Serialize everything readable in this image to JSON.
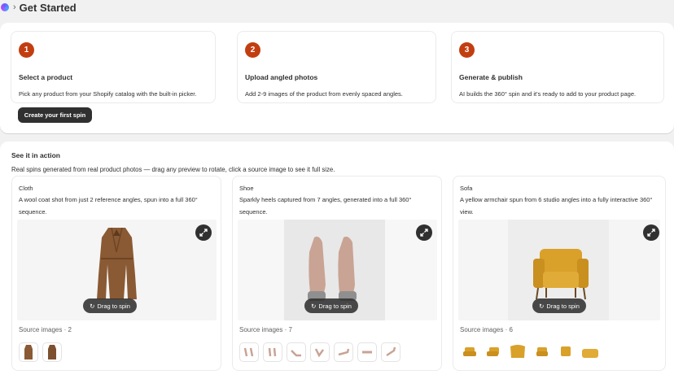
{
  "header": {
    "title": "Get Started"
  },
  "steps": [
    {
      "number": "1",
      "title": "Select a product",
      "description": "Pick any product from your Shopify catalog with the built-in picker."
    },
    {
      "number": "2",
      "title": "Upload angled photos",
      "description": "Add 2-9 images of the product from evenly spaced angles."
    },
    {
      "number": "3",
      "title": "Generate & publish",
      "description": "AI builds the 360° spin and it's ready to add to your product page."
    }
  ],
  "cta": {
    "label": "Create your first spin"
  },
  "demo": {
    "title": "See it in action",
    "subtitle": "Real spins generated from real product photos — drag any preview to rotate, click a source image to see it full size.",
    "drag_label": "Drag to spin",
    "examples": [
      {
        "label": "Cloth",
        "description": "A wool coat shot from just 2 reference angles, spun into a full 360° sequence.",
        "source_label": "Source images · 2",
        "thumb_count": 2
      },
      {
        "label": "Shoe",
        "description": "Sparkly heels captured from 7 angles, generated into a full 360° sequence.",
        "source_label": "Source images · 7",
        "thumb_count": 7
      },
      {
        "label": "Sofa",
        "description": "A yellow armchair spun from 6 studio angles into a fully interactive 360° view.",
        "source_label": "Source images · 6",
        "thumb_count": 6
      }
    ]
  },
  "colors": {
    "accent": "#c23e10",
    "primary_button": "#303030",
    "coat": "#8a5a34",
    "chair": "#d9a12a"
  },
  "icons": [
    "app-icon",
    "expand-icon",
    "rotate-icon"
  ]
}
